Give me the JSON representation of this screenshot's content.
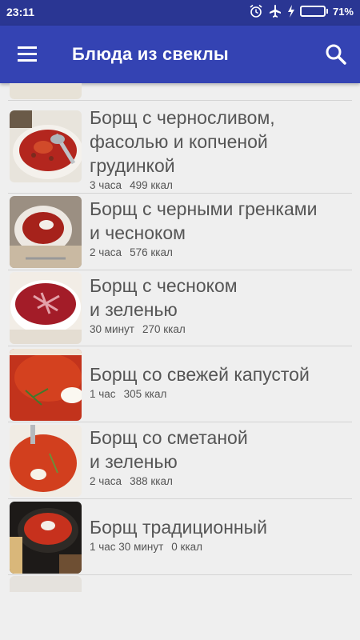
{
  "status_bar": {
    "time": "23:11",
    "battery_percent_label": "71%",
    "battery_level": 0.71,
    "icons": [
      "alarm-icon",
      "airplane-icon",
      "charging-icon",
      "battery-icon"
    ]
  },
  "app_bar": {
    "title": "Блюда из свеклы",
    "menu_icon": "hamburger-menu-icon",
    "search_icon": "search-icon"
  },
  "recipes": [
    {
      "name_lines": [
        "Борщ с черносливом,",
        "фасолью и копченой",
        "грудинкой"
      ],
      "time": "3 часа",
      "kcal": "499 ккал"
    },
    {
      "name_lines": [
        "Борщ с черными гренками",
        "и чесноком"
      ],
      "time": "2 часа",
      "kcal": "576 ккал"
    },
    {
      "name_lines": [
        "Борщ с чесноком",
        "и зеленью"
      ],
      "time": "30 минут",
      "kcal": "270 ккал"
    },
    {
      "name_lines": [
        "Борщ со свежей капустой"
      ],
      "time": "1 час",
      "kcal": "305 ккал"
    },
    {
      "name_lines": [
        "Борщ со сметаной",
        "и зеленью"
      ],
      "time": "2 часа",
      "kcal": "388 ккал"
    },
    {
      "name_lines": [
        "Борщ традиционный"
      ],
      "time": "1 час 30 минут",
      "kcal": "0 ккал"
    }
  ]
}
